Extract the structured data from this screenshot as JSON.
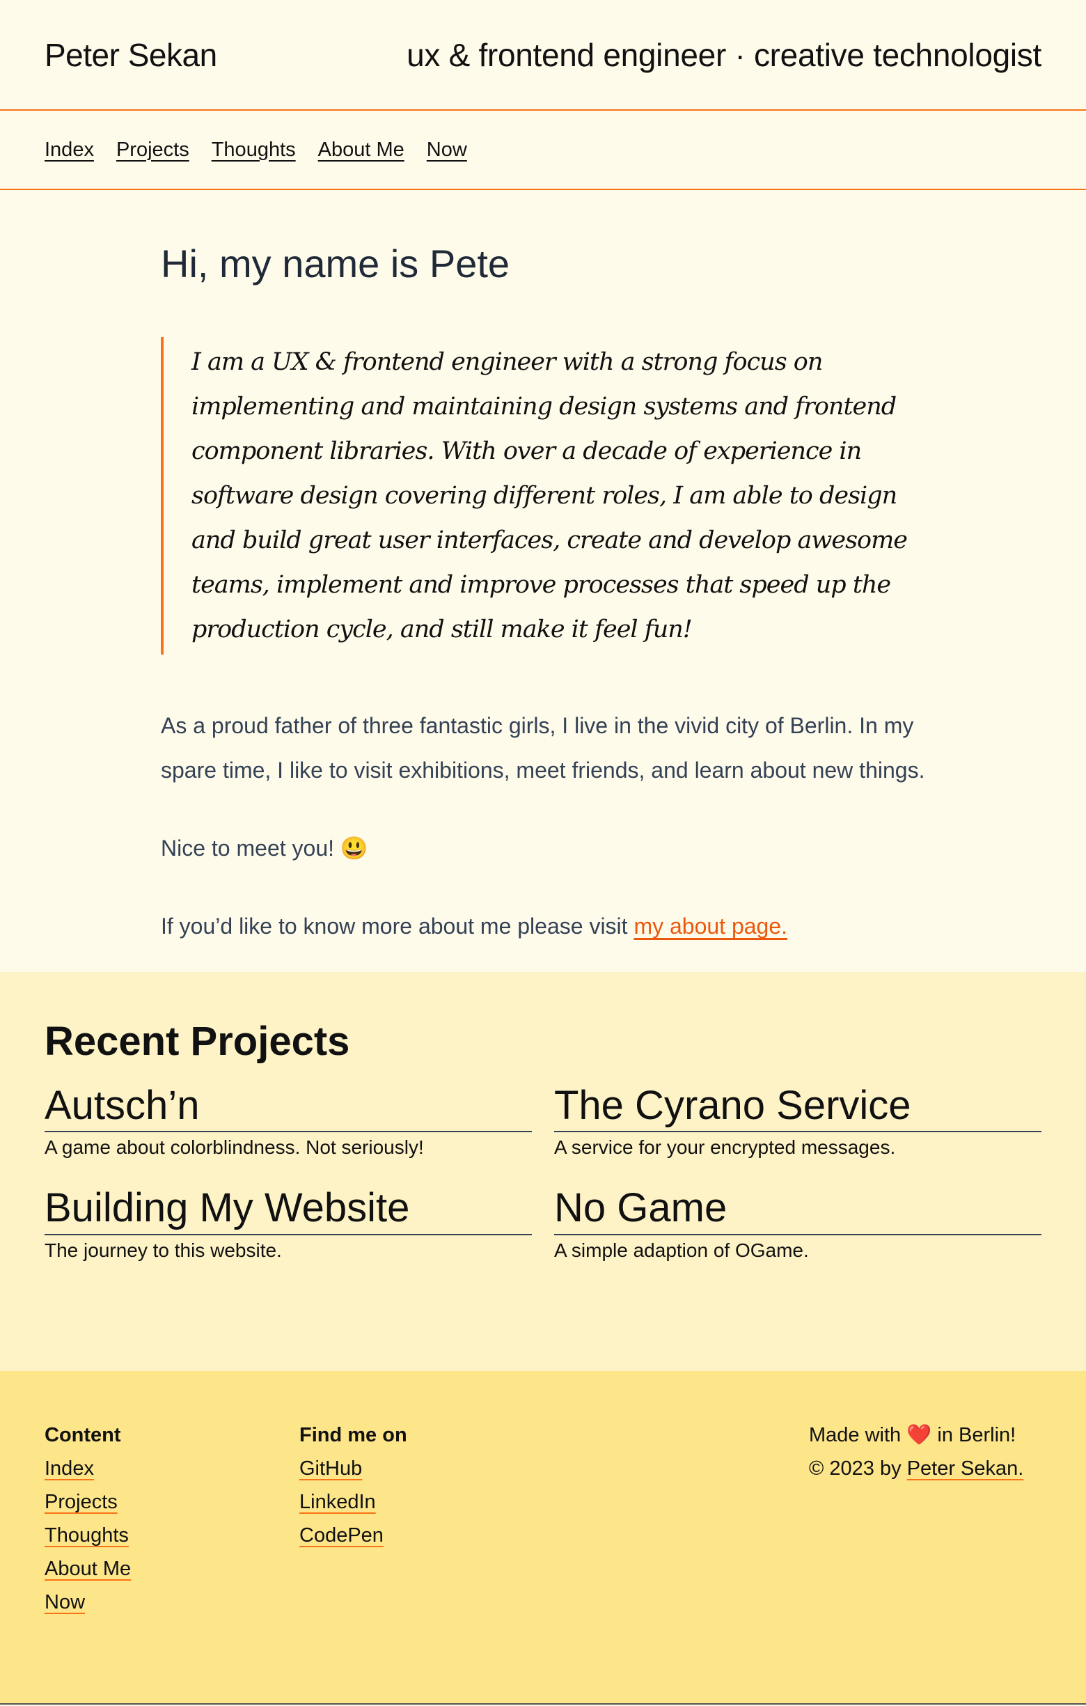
{
  "header": {
    "brand": "Peter Sekan",
    "tagline": "ux & frontend engineer · creative technologist"
  },
  "nav": [
    "Index",
    "Projects",
    "Thoughts",
    "About Me",
    "Now"
  ],
  "main": {
    "greeting": "Hi, my name is Pete",
    "intro": "I am a UX & frontend engineer with a strong focus on implementing and maintaining design systems and frontend component libraries. With over a decade of experience in software design covering different roles, I am able to design and build great user interfaces, create and develop awesome teams, implement and improve processes that speed up the production cycle, and still make it feel fun!",
    "paragraph1": "As a proud father of three fantastic girls, I live in the vivid city of Berlin. In my spare time, I like to visit exhibitions, meet friends, and learn about new things.",
    "paragraph2": "Nice to meet you! 😃",
    "paragraph3_prefix": "If you’d like to know more about me please visit ",
    "about_link": "my about page."
  },
  "projects": {
    "title": "Recent Projects",
    "items": [
      {
        "title": "Autsch’n",
        "description": "A game about colorblindness. Not seriously!"
      },
      {
        "title": "The Cyrano Service",
        "description": "A service for your encrypted messages."
      },
      {
        "title": "Building My Website",
        "description": "The journey to this website."
      },
      {
        "title": "No Game",
        "description": "A simple adaption of OGame."
      }
    ]
  },
  "footer": {
    "content_heading": "Content",
    "content_links": [
      "Index",
      "Projects",
      "Thoughts",
      "About Me",
      "Now"
    ],
    "find_heading": "Find me on",
    "find_links": [
      "GitHub",
      "LinkedIn",
      "CodePen"
    ],
    "made_prefix": "Made with ",
    "heart": "❤️",
    "made_suffix": " in Berlin!",
    "copyright_prefix": "© 2023 by ",
    "copyright_link": "Peter Sekan."
  },
  "colors": {
    "accent": "#f97316",
    "link": "#ea580c",
    "page_bg": "#fffbeb",
    "projects_bg": "#fef3c7",
    "footer_bg": "#fde68a"
  }
}
